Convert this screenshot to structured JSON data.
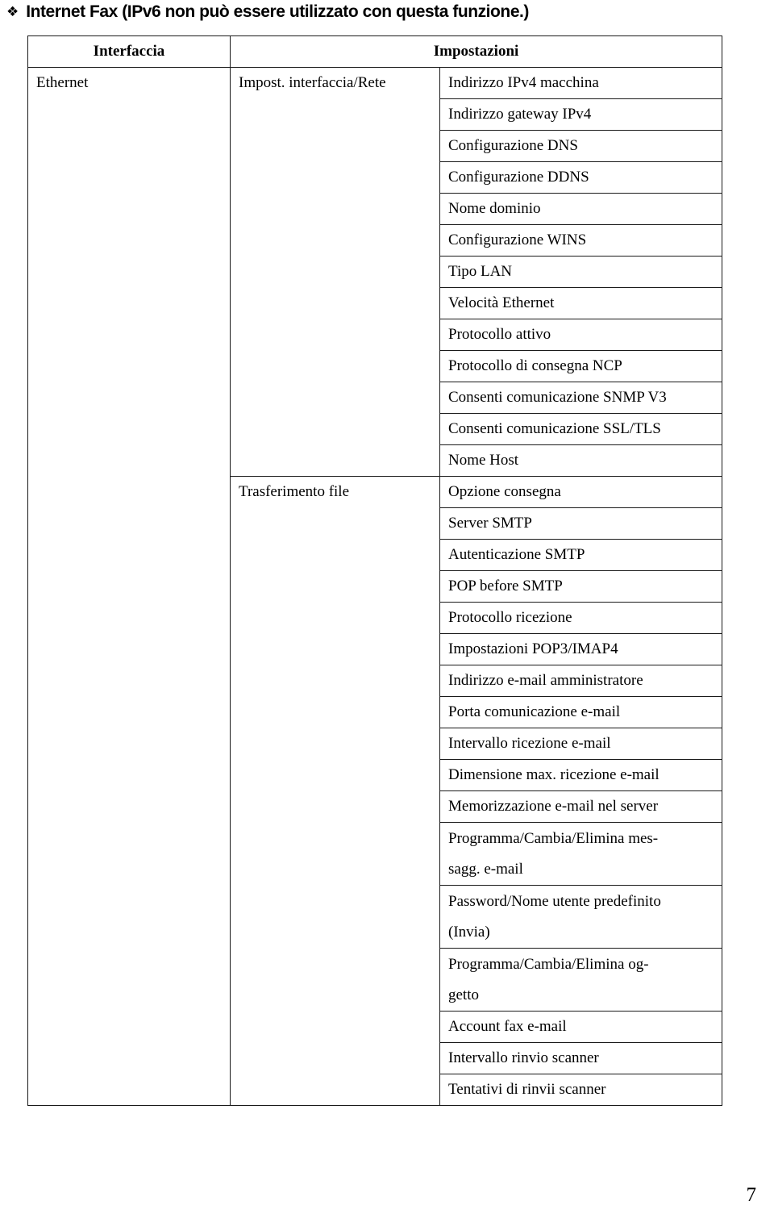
{
  "heading": {
    "bullet_icon": "floret-bullet-icon",
    "bullet_glyph": "❖",
    "text": "Internet Fax (IPv6 non può essere utilizzato con questa funzione.)"
  },
  "table": {
    "headers": {
      "interface": "Interfaccia",
      "settings": "Impostazioni"
    },
    "interface_value": "Ethernet",
    "groups": [
      {
        "label": "Impost. interfaccia/Rete",
        "settings": [
          "Indirizzo IPv4 macchina",
          "Indirizzo gateway IPv4",
          "Configurazione DNS",
          "Configurazione DDNS",
          "Nome dominio",
          "Configurazione WINS",
          "Tipo LAN",
          "Velocità Ethernet",
          "Protocollo attivo",
          "Protocollo di consegna NCP",
          "Consenti comunicazione SNMP V3",
          "Consenti comunicazione SSL/TLS",
          "Nome Host"
        ]
      },
      {
        "label": "Trasferimento file",
        "settings": [
          "Opzione consegna",
          "Server SMTP",
          "Autenticazione SMTP",
          "POP before SMTP",
          "Protocollo ricezione",
          "Impostazioni POP3/IMAP4",
          "Indirizzo e-mail amministratore",
          "Porta comunicazione e-mail",
          "Intervallo ricezione e-mail",
          "Dimensione max. ricezione e-mail",
          "Memorizzazione e-mail nel server",
          "Programma/Cambia/Elimina mes-\nsagg. e-mail",
          "Password/Nome utente predefinito\n(Invia)",
          "Programma/Cambia/Elimina og-\ngetto",
          "Account fax e-mail",
          "Intervallo rinvio scanner",
          "Tentativi di rinvii scanner"
        ]
      }
    ]
  },
  "footer": {
    "page_number": "7"
  }
}
